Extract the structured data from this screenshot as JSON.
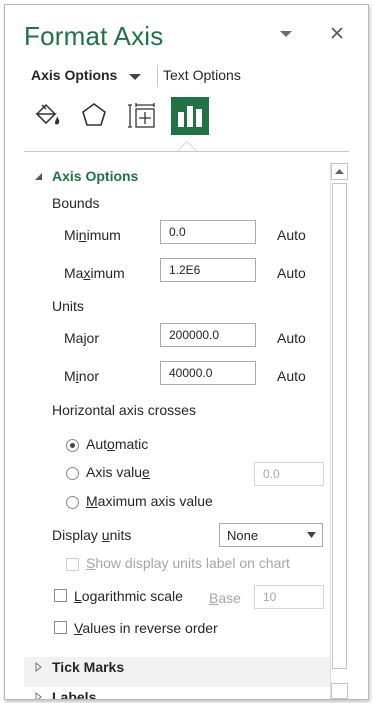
{
  "pane": {
    "title": "Format Axis",
    "tabs": {
      "axis_options": "Axis Options",
      "text_options": "Text Options"
    },
    "icons": [
      "paint-bucket-icon",
      "pentagon-icon",
      "size-properties-icon",
      "bar-chart-icon"
    ],
    "active_icon": "bar-chart-icon",
    "accent_color": "#217346"
  },
  "axis_options": {
    "section_title": "Axis Options",
    "bounds": {
      "heading": "Bounds",
      "minimum": {
        "pre": "Mi",
        "key": "n",
        "post": "imum",
        "value": "0.0",
        "auto": "Auto"
      },
      "maximum": {
        "pre": "Ma",
        "key": "x",
        "post": "imum",
        "value": "1.2E6",
        "auto": "Auto"
      }
    },
    "units": {
      "heading": "Units",
      "major": {
        "label": "Major",
        "value": "200000.0",
        "auto": "Auto"
      },
      "minor": {
        "pre": "M",
        "key": "i",
        "post": "nor",
        "value": "40000.0",
        "auto": "Auto"
      }
    },
    "crosses": {
      "heading": "Horizontal axis crosses",
      "automatic": {
        "pre": "Aut",
        "key": "o",
        "post": "matic",
        "selected": true
      },
      "axis_value": {
        "pre": "Axis valu",
        "key": "e",
        "post": "",
        "value": "0.0",
        "selected": false
      },
      "max_axis_value": {
        "pre": "",
        "key": "M",
        "post": "aximum axis value",
        "selected": false
      }
    },
    "display_units": {
      "pre": "Display ",
      "key": "u",
      "post": "nits",
      "selected": "None",
      "show_label": {
        "pre": "",
        "key": "S",
        "post": "how display units label on chart",
        "checked": false
      }
    },
    "logarithmic": {
      "pre": "",
      "key": "L",
      "post": "ogarithmic scale",
      "checked": false,
      "base_key": "B",
      "base_post": "ase",
      "base_value": "10"
    },
    "reverse": {
      "pre": "",
      "key": "V",
      "post": "alues in reverse order",
      "checked": false
    }
  },
  "collapsed_sections": {
    "tick_marks": "Tick Marks",
    "labels": "Labels"
  }
}
